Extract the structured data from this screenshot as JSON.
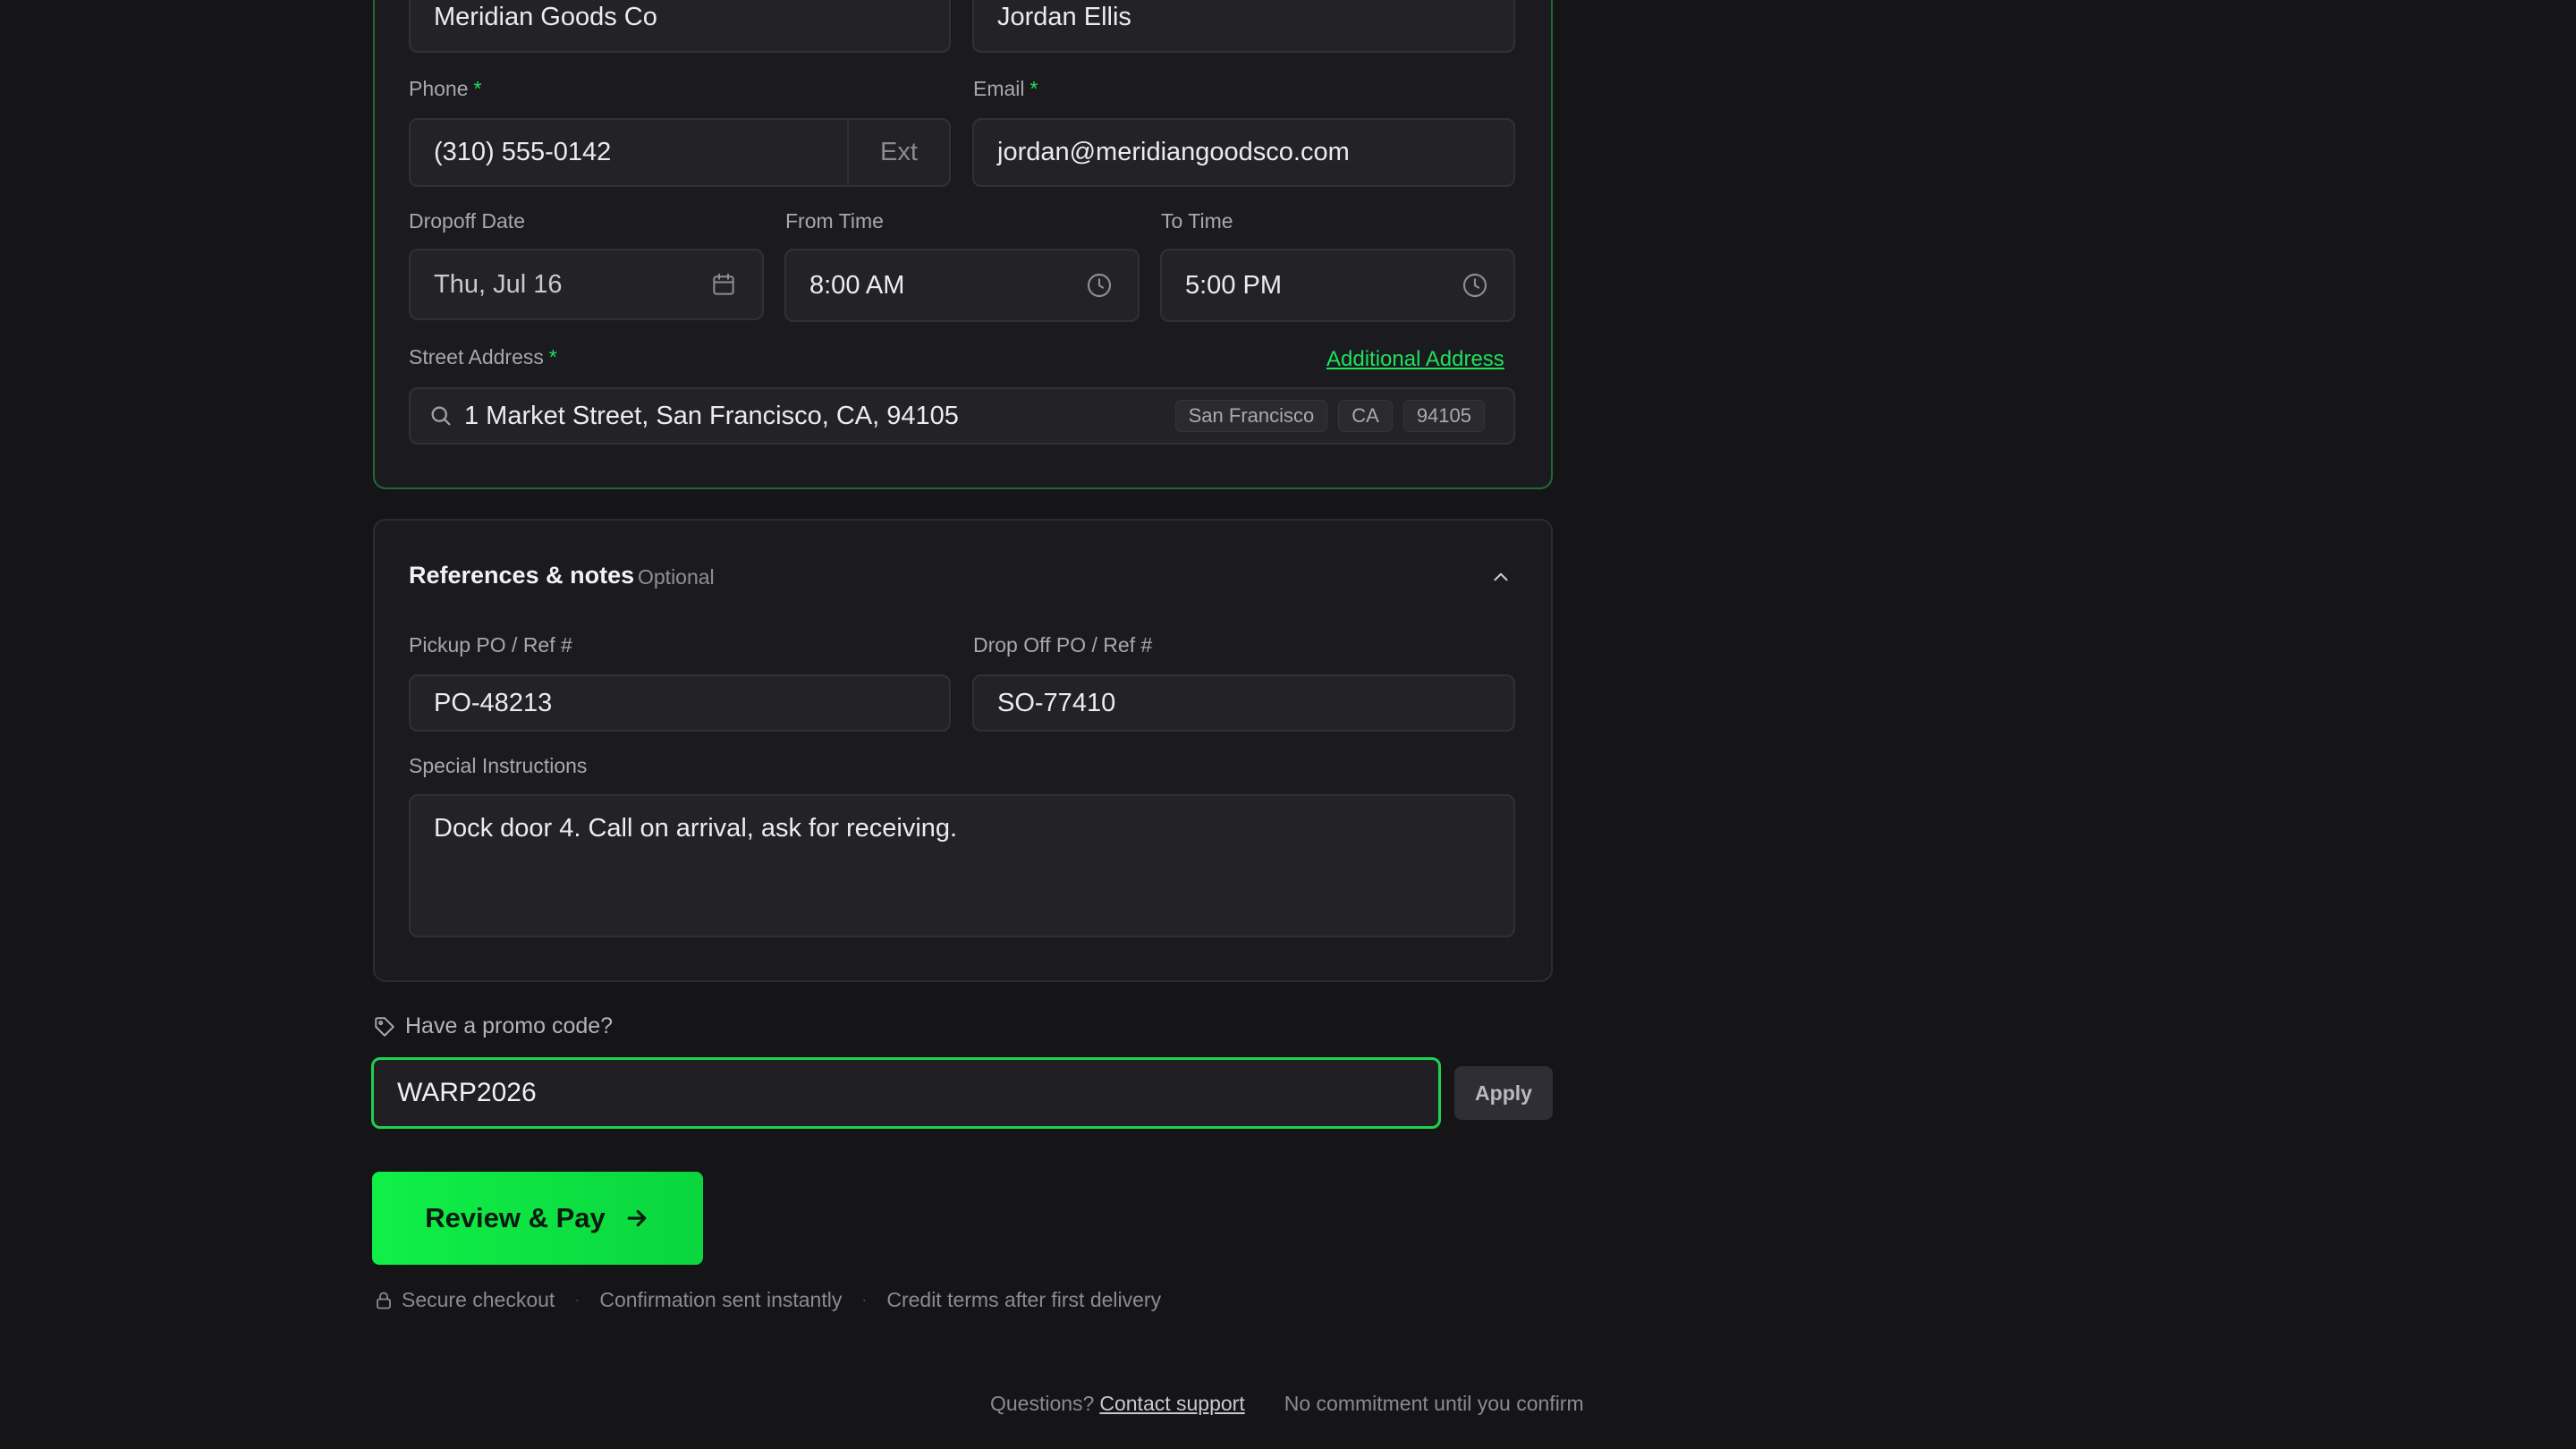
{
  "shipper": {
    "company_value": "Meridian Goods Co",
    "contact_value": "Jordan Ellis",
    "phone_label": "Phone",
    "phone_value": "(310) 555-0142",
    "phone_ext_placeholder": "Ext",
    "email_label": "Email",
    "email_value": "jordan@meridiangoodsco.com",
    "dropoff_date_label": "Dropoff Date",
    "dropoff_date_value": "Thu, Jul 16",
    "from_time_label": "From Time",
    "from_time_value": "8:00 AM",
    "to_time_label": "To Time",
    "to_time_value": "5:00 PM",
    "street_label": "Street Address",
    "additional_address_link": "Additional Address",
    "street_value": "1 Market Street, San Francisco, CA, 94105",
    "chips": [
      "San Francisco",
      "CA",
      "94105"
    ],
    "required_marker": "*"
  },
  "notes": {
    "title": "References & notes",
    "optional_tag": "Optional",
    "pickup_po_label": "Pickup PO / Ref #",
    "pickup_po_value": "PO-48213",
    "dropoff_po_label": "Drop Off PO / Ref #",
    "dropoff_po_value": "SO-77410",
    "instructions_label": "Special Instructions",
    "instructions_value": "Dock door 4. Call on arrival, ask for receiving."
  },
  "promo": {
    "prompt": "Have a promo code?",
    "value": "WARP2026",
    "apply_label": "Apply"
  },
  "checkout": {
    "cta_label": "Review & Pay",
    "trust_items": [
      "Secure checkout",
      "Confirmation sent instantly",
      "Credit terms after first delivery"
    ],
    "separator": "·"
  },
  "footer": {
    "questions_text": "Questions?",
    "support_link": "Contact support",
    "commitment_text": "No commitment until you confirm"
  },
  "colors": {
    "accent": "#1ee05a",
    "background": "#151518",
    "card": "#1b1b1f",
    "field": "#232327"
  },
  "icons": {
    "calendar": "calendar-icon",
    "clock": "clock-icon",
    "search": "search-icon",
    "chevron": "chevron-up-icon",
    "tag": "tag-icon",
    "lock": "lock-icon",
    "arrow": "arrow-right-icon"
  }
}
